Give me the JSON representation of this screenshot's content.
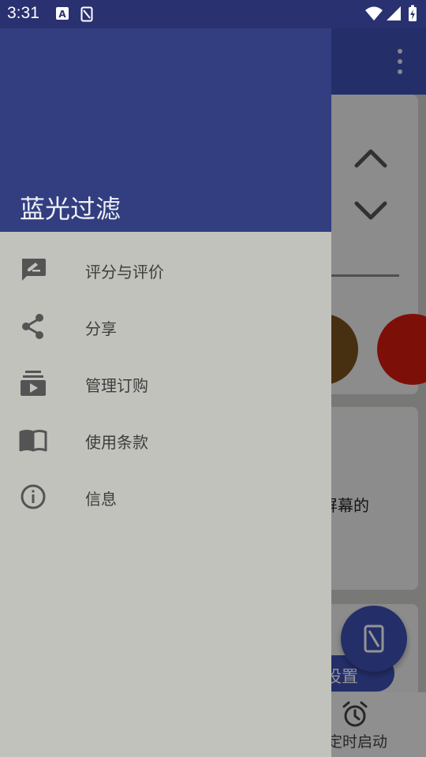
{
  "status_bar": {
    "time": "3:31",
    "icons": [
      "font-notification-icon",
      "screen-filter-notification-icon",
      "wifi-icon",
      "cellular-signal-icon",
      "battery-charging-icon"
    ]
  },
  "drawer": {
    "title": "蓝光过滤",
    "items": [
      {
        "label": "评分与评价",
        "icon": "rate-review-icon"
      },
      {
        "label": "分享",
        "icon": "share-icon"
      },
      {
        "label": "管理订购",
        "icon": "subscriptions-icon"
      },
      {
        "label": "使用条款",
        "icon": "book-icon"
      },
      {
        "label": "信息",
        "icon": "info-icon"
      }
    ]
  },
  "background": {
    "card_text": "屏幕的",
    "pill_label": "设置",
    "bottom_nav_label": "定时启动"
  },
  "colors": {
    "primary": "#3f51b5",
    "drawer_header": "#323e80",
    "drawer_body": "#c2c2bd",
    "status_bar": "#2a3170",
    "filter_brown": "#7a5320",
    "filter_red": "#d81b10"
  }
}
